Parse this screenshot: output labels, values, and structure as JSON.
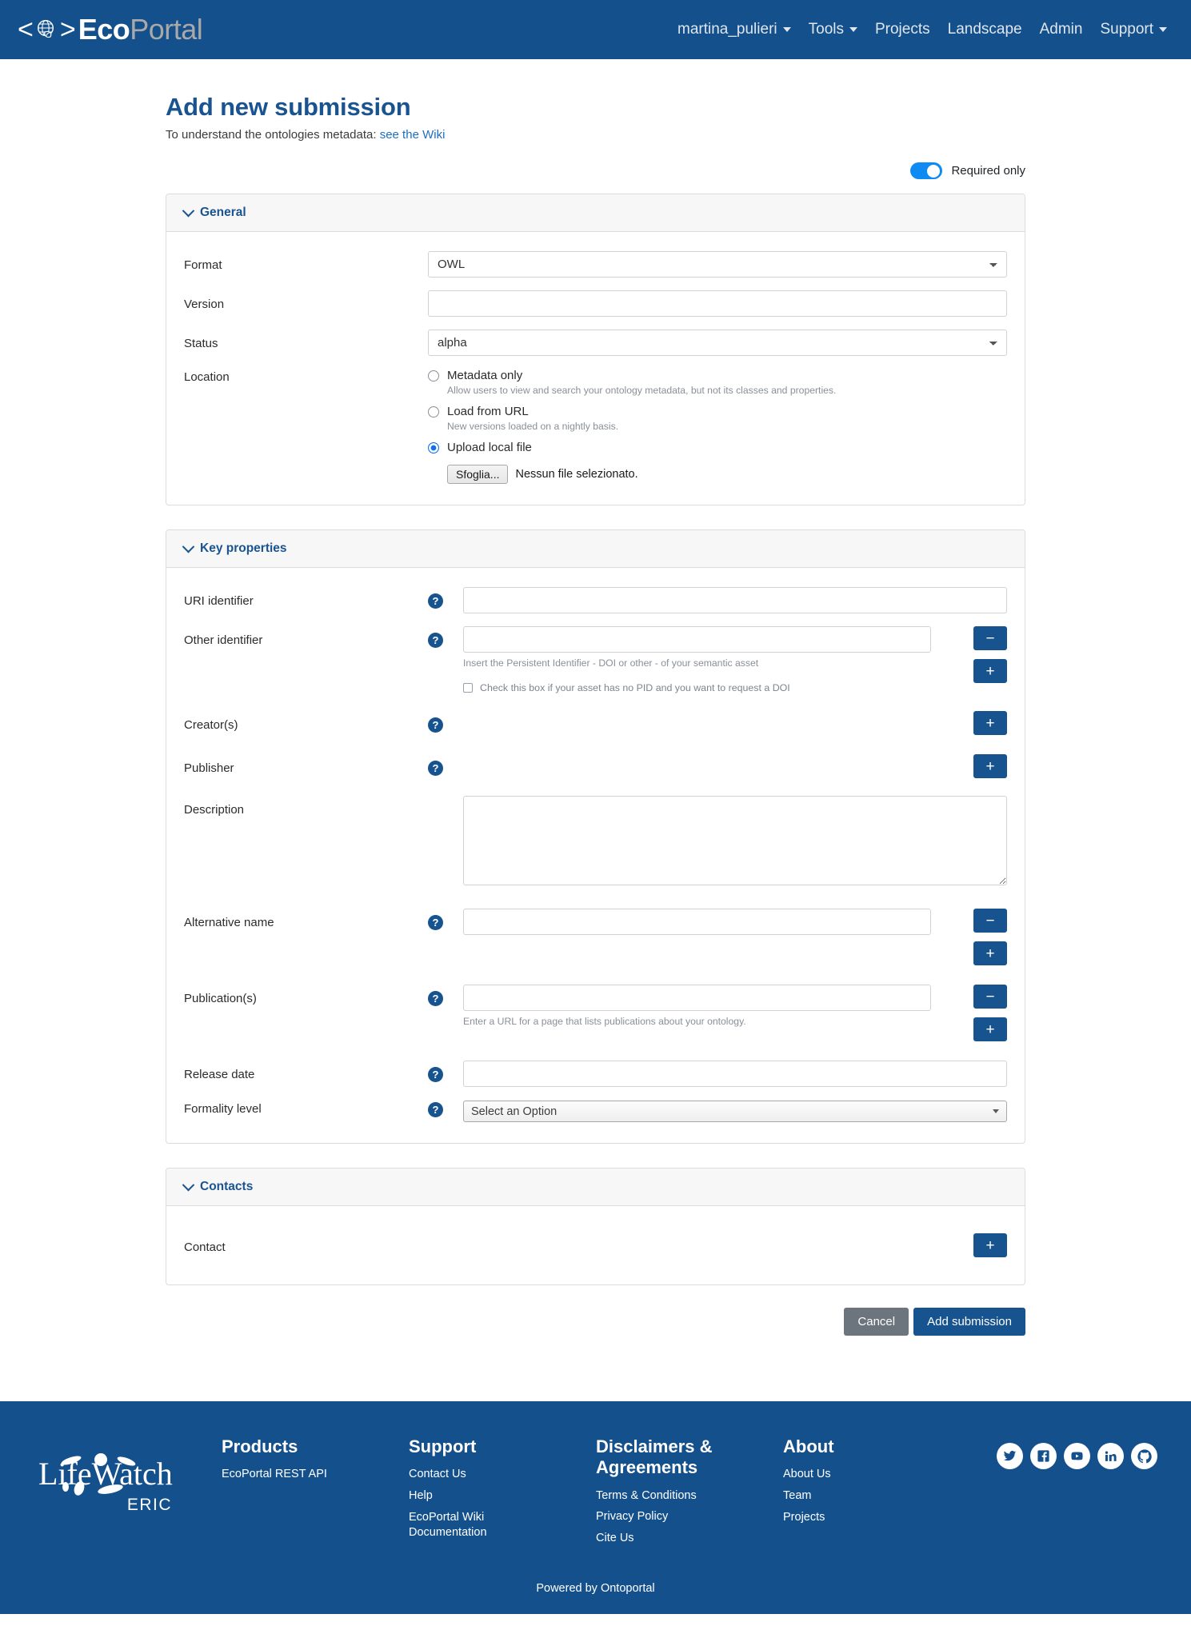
{
  "brand": {
    "eco": "Eco",
    "portal": "Portal",
    "left_bracket": "<",
    "right_bracket": ">"
  },
  "nav": {
    "items": [
      {
        "label": "martina_pulieri",
        "caret": true
      },
      {
        "label": "Tools",
        "caret": true
      },
      {
        "label": "Projects",
        "caret": false
      },
      {
        "label": "Landscape",
        "caret": false
      },
      {
        "label": "Admin",
        "caret": false
      },
      {
        "label": "Support",
        "caret": true
      }
    ]
  },
  "header": {
    "title": "Add new submission",
    "subtitle_text": "To understand the ontologies metadata:",
    "subtitle_link": "see the Wiki"
  },
  "toggle": {
    "label": "Required only",
    "on": true,
    "accent": "#0d8bf2"
  },
  "general": {
    "section_title": "General",
    "format": {
      "label": "Format",
      "value": "OWL"
    },
    "version": {
      "label": "Version",
      "value": ""
    },
    "status": {
      "label": "Status",
      "value": "alpha"
    },
    "location": {
      "label": "Location",
      "options": [
        {
          "label": "Metadata only",
          "desc": "Allow users to view and search your ontology metadata, but not its classes and properties.",
          "checked": false
        },
        {
          "label": "Load from URL",
          "desc": "New versions loaded on a nightly basis.",
          "checked": false
        },
        {
          "label": "Upload local file",
          "desc": "",
          "checked": true
        }
      ],
      "file_button": "Sfoglia...",
      "file_status": "Nessun file selezionato."
    }
  },
  "key_properties": {
    "section_title": "Key properties",
    "uri_identifier": {
      "label": "URI identifier",
      "value": ""
    },
    "other_identifier": {
      "label": "Other identifier",
      "value": "",
      "hint": "Insert the Persistent Identifier - DOI or other - of your semantic asset",
      "checkbox_label": "Check this box if your asset has no PID and you want to request a DOI",
      "checkbox_checked": false,
      "minus": "−",
      "plus": "+"
    },
    "creators": {
      "label": "Creator(s)",
      "plus": "+"
    },
    "publisher": {
      "label": "Publisher",
      "plus": "+"
    },
    "description": {
      "label": "Description",
      "value": ""
    },
    "alternative_name": {
      "label": "Alternative name",
      "value": "",
      "minus": "−",
      "plus": "+"
    },
    "publications": {
      "label": "Publication(s)",
      "value": "",
      "hint": "Enter a URL for a page that lists publications about your ontology.",
      "minus": "−",
      "plus": "+"
    },
    "release_date": {
      "label": "Release date",
      "value": ""
    },
    "formality_level": {
      "label": "Formality level",
      "value": "Select an Option"
    }
  },
  "contacts": {
    "section_title": "Contacts",
    "contact": {
      "label": "Contact",
      "plus": "+"
    }
  },
  "actions": {
    "cancel": "Cancel",
    "submit": "Add submission"
  },
  "footer": {
    "logo_name": "LifeWatch",
    "logo_sub": "ERIC",
    "columns": [
      {
        "title": "Products",
        "links": [
          "EcoPortal REST API"
        ]
      },
      {
        "title": "Support",
        "links": [
          "Contact Us",
          "Help",
          "EcoPortal Wiki Documentation"
        ]
      },
      {
        "title": "Disclaimers & Agreements",
        "links": [
          "Terms & Conditions",
          "Privacy Policy",
          "Cite Us"
        ]
      },
      {
        "title": "About",
        "links": [
          "About Us",
          "Team",
          "Projects"
        ]
      }
    ],
    "socials": [
      "twitter-icon",
      "facebook-icon",
      "youtube-icon",
      "linkedin-icon",
      "github-icon"
    ],
    "powered": "Powered by Ontoportal"
  }
}
